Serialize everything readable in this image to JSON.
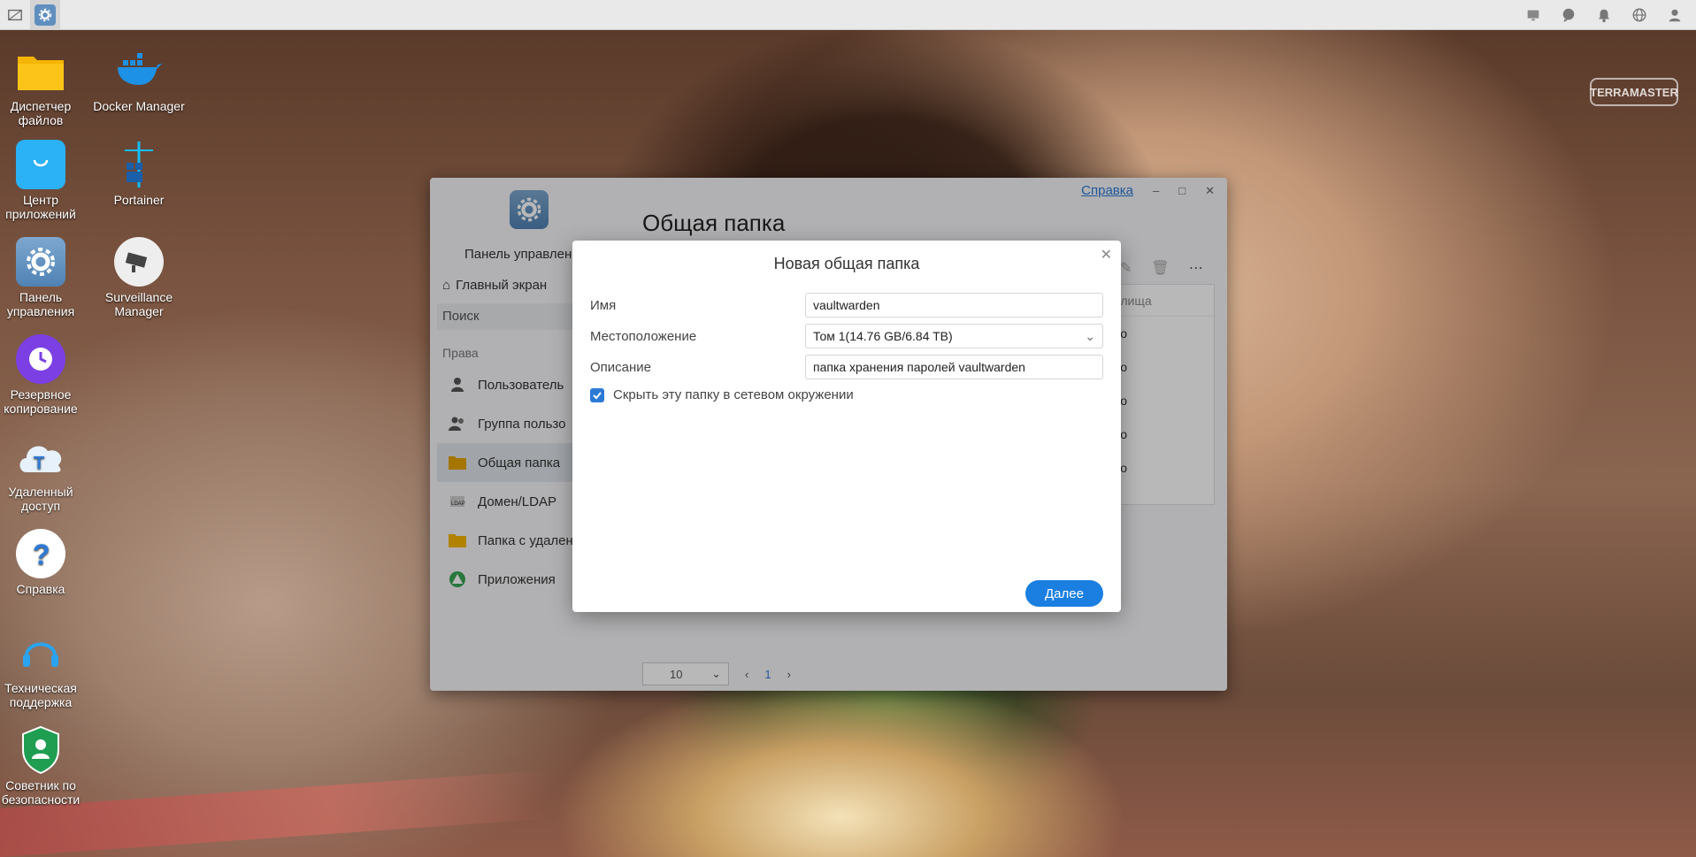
{
  "brand": {
    "logo_text": "TERRAMASTER"
  },
  "taskbar": {
    "left_icons": [
      "desktop-icon",
      "settings-icon"
    ],
    "right_icons": [
      "monitor-icon",
      "chat-icon",
      "bell-icon",
      "globe-icon",
      "user-icon"
    ]
  },
  "desktop": {
    "icons": [
      {
        "label": "Диспетчер файлов",
        "icon": "folder-icon",
        "color": "#f5b400"
      },
      {
        "label": "Docker Manager",
        "icon": "docker-icon",
        "color": "#1d91e6"
      },
      {
        "label": "Центр приложений",
        "icon": "shopping-bag-icon",
        "color": "#2bb1f5"
      },
      {
        "label": "Portainer",
        "icon": "portainer-icon",
        "color": "#13bef9"
      },
      {
        "label": "Панель управления",
        "icon": "gear-icon",
        "color": "#5f8fbf"
      },
      {
        "label": "Surveillance Manager",
        "icon": "camera-icon",
        "color": "#eeeeee"
      },
      {
        "label": "Резервное копирование",
        "icon": "clock-icon",
        "color": "#7b3fe4"
      },
      {
        "label": "Удаленный доступ",
        "icon": "cloud-icon",
        "color": "#e6f1fb"
      },
      {
        "label": "Справка",
        "icon": "question-icon",
        "color": "#ffffff"
      },
      {
        "label": "Техническая поддержка",
        "icon": "headset-icon",
        "color": "#2aa3f0"
      },
      {
        "label": "Советник по безопасности",
        "icon": "shield-icon",
        "color": "#1f9e52"
      }
    ]
  },
  "window": {
    "help_link": "Справка",
    "app_label": "Панель управлен",
    "title": "Общая папка",
    "sidebar": {
      "home": "Главный экран",
      "search": "Поиск",
      "section": "Права",
      "items": [
        {
          "label": "Пользователь",
          "icon": "user-icon"
        },
        {
          "label": "Группа пользо",
          "icon": "users-icon"
        },
        {
          "label": "Общая папка",
          "icon": "shared-folder-icon"
        },
        {
          "label": "Домен/LDAP",
          "icon": "ldap-icon"
        },
        {
          "label": "Папка с удален",
          "icon": "remote-folder-icon"
        },
        {
          "label": "Приложения",
          "icon": "apps-icon"
        }
      ]
    },
    "table": {
      "header_partial": "анилища",
      "rows_partial": [
        "нено",
        "нено",
        "нено",
        "нено",
        "нено"
      ]
    },
    "pager": {
      "page_size": "10",
      "current_page": "1"
    }
  },
  "dialog": {
    "title": "Новая общая папка",
    "fields": {
      "name_label": "Имя",
      "name_value": "vaultwarden",
      "location_label": "Местоположение",
      "location_value": "Том 1(14.76 GB/6.84 TB)",
      "description_label": "Описание",
      "description_value": "папка хранения паролей vaultwarden"
    },
    "hide_checkbox": {
      "label": "Скрыть эту папку в сетевом окружении",
      "checked": true
    },
    "next_button": "Далее"
  }
}
